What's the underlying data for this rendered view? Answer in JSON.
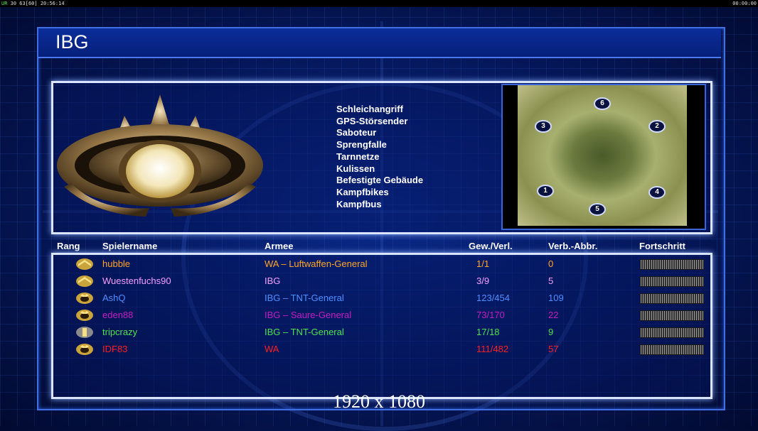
{
  "status_bar": {
    "ur_label": "UR",
    "frame_numbers": "30 63",
    "fps": "[60]",
    "clock": "20:56:14",
    "timer": "00:00:00"
  },
  "title": "IBG",
  "features": [
    "Schleichangriff",
    "GPS-Störsender",
    "Saboteur",
    "Sprengfalle",
    "Tarnnetze",
    "Kulissen",
    "Befestigte Gebäude",
    "Kampfbikes",
    "Kampfbus"
  ],
  "map_start_positions": [
    "6",
    "3",
    "2",
    "1",
    "4",
    "5"
  ],
  "table": {
    "headers": {
      "rank": "Rang",
      "name": "Spielername",
      "army": "Armee",
      "winloss": "Gew./Verl.",
      "disconnect": "Verb.-Abbr.",
      "progress": "Fortschritt"
    },
    "rows": [
      {
        "name": "hubble",
        "army": "WA – Luftwaffen-General",
        "winloss": "1/1",
        "disconnect": "0",
        "color": "#ffa726",
        "rank_icon": "chevron-rank-icon"
      },
      {
        "name": "Wuestenfuchs90",
        "army": "IBG",
        "winloss": "3/9",
        "disconnect": "5",
        "color": "#f0a0ff",
        "rank_icon": "chevron-rank-icon"
      },
      {
        "name": "AshQ",
        "army": "IBG – TNT-General",
        "winloss": "123/454",
        "disconnect": "109",
        "color": "#4f8fff",
        "rank_icon": "star-rank-icon"
      },
      {
        "name": "eden88",
        "army": "IBG – Saure-General",
        "winloss": "73/170",
        "disconnect": "22",
        "color": "#c020c0",
        "rank_icon": "star-rank-icon"
      },
      {
        "name": "tripcrazy",
        "army": "IBG – TNT-General",
        "winloss": "17/18",
        "disconnect": "9",
        "color": "#4ee24e",
        "rank_icon": "bar-rank-icon"
      },
      {
        "name": "IDF83",
        "army": "WA",
        "winloss": "111/482",
        "disconnect": "57",
        "color": "#ff2020",
        "rank_icon": "star-rank-icon"
      }
    ]
  },
  "resolution_label": "1920 x 1080"
}
